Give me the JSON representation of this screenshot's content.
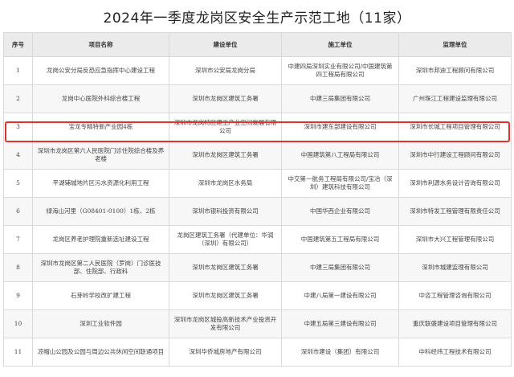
{
  "title": "2024年一季度龙岗区安全生产示范工地（11家）",
  "columns": [
    "序号",
    "项目名称",
    "建设单位",
    "施工单位",
    "监理单位"
  ],
  "highlight_color": "#e0312b",
  "rows": [
    {
      "no": "1",
      "name": "龙岗公安分局反恐应急指挥中心建设工程",
      "builder": "深圳市公安局龙岗分局",
      "contractor": "中建四局深圳实业有限公司/中国建筑第四工程局有限公司",
      "supervisor": "深圳市邦迪工程顾问有限公司"
    },
    {
      "no": "2",
      "name": "龙岗中心医院外科综合楼工程",
      "builder": "深圳市龙岗区建筑工务署",
      "contractor": "中建三局集团有限公司",
      "supervisor": "广州珠江工程建设监理有限公司"
    },
    {
      "no": "3",
      "name": "宝龙专精特新产业园4栋",
      "builder": "深圳市龙岗特区建工产业空间发展有限公司",
      "contractor": "深圳市建东部建设有限公司",
      "supervisor": "深圳市长城工程项目管理有限公司"
    },
    {
      "no": "4",
      "name": "深圳市龙岗区第六人民医院门诊住院综合楼及养老楼",
      "builder": "深圳市龙岗区建筑工务署",
      "contractor": "中国建筑第八工程局有限公司",
      "supervisor": "深圳市中行建设工程顾问有限公司"
    },
    {
      "no": "5",
      "name": "平湖辅城地片区污水资源化利用工程",
      "builder": "深圳市龙岗区水务局",
      "contractor": "中交第一航务工程局有限公司/宝冶（深圳）建筑科技有限公司",
      "supervisor": "深圳市利源水务设计咨询有限公司"
    },
    {
      "no": "6",
      "name": "绿海山河里（G08401-0100）1栋、2栋",
      "builder": "深圳市银科投资有限公司",
      "contractor": "中国华西企业有限公司",
      "supervisor": "深圳市特发工程管理有限责任公司"
    },
    {
      "no": "7",
      "name": "龙岗区养老护理院重新选址建设工程",
      "builder": "龙岗区建筑工务署（代建单位：华润（深圳）有限公司）",
      "contractor": "中国建筑第五工程局有限公司",
      "supervisor": "深圳市大兴工程管理有限公司"
    },
    {
      "no": "8",
      "name": "深圳市龙岗区第二人民医院（罗岗）门诊医技部、住院部、行政科",
      "builder": "深圳市龙岗区建筑工务署",
      "contractor": "中建三局集团有限公司",
      "supervisor": "深圳市城建监理有限公司"
    },
    {
      "no": "9",
      "name": "石芽岭学校改扩建工程",
      "builder": "深圳市龙岗区建筑工务署",
      "contractor": "中建八局第一建设有限公司",
      "supervisor": "中咨工程管理咨询有限公司"
    },
    {
      "no": "10",
      "name": "深圳工业软件园",
      "builder": "深圳市龙岗区城投高新技术产业投资开发有限公司",
      "contractor": "中建五局第三建设有限公司",
      "supervisor": "重庆联盛建设项目管理有限公司"
    },
    {
      "no": "11",
      "name": "凉帽山公园及公园与周边公共休闲空间联通项目",
      "builder": "深圳华侨城房地产有限公司",
      "contractor": "深圳市建设（集团）有限公司",
      "supervisor": "中科经纬工程技术有限公司"
    }
  ]
}
